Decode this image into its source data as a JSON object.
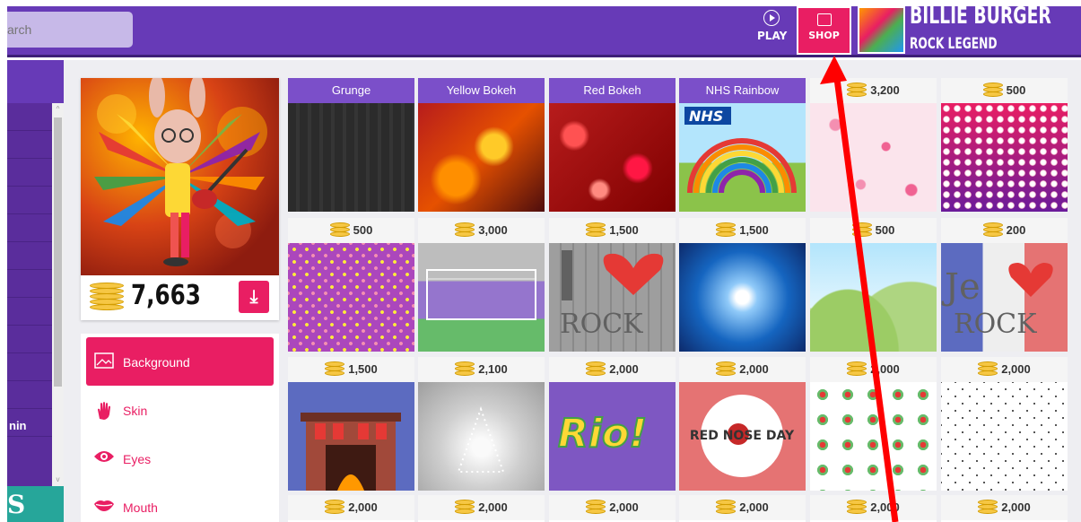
{
  "search": {
    "placeholder": "arch"
  },
  "header": {
    "play_label": "PLAY",
    "shop_label": "SHOP",
    "user_name": "BILLIE BURGER",
    "user_title": "ROCK LEGEND"
  },
  "leftnav": {
    "partial_label": "nin",
    "bottom_text": "S"
  },
  "preview": {
    "coins": "7,663"
  },
  "categories": [
    {
      "label": "Background",
      "icon": "image-icon",
      "active": true
    },
    {
      "label": "Skin",
      "icon": "hand-icon",
      "active": false
    },
    {
      "label": "Eyes",
      "icon": "eye-icon",
      "active": false
    },
    {
      "label": "Mouth",
      "icon": "lips-icon",
      "active": false
    }
  ],
  "tiles": [
    {
      "head": "Grunge",
      "named": true
    },
    {
      "head": "Yellow Bokeh",
      "named": true
    },
    {
      "head": "Red Bokeh",
      "named": true
    },
    {
      "head": "NHS Rainbow",
      "named": true
    },
    {
      "head": "3,200",
      "named": false
    },
    {
      "head": "500",
      "named": false
    },
    {
      "head": "500",
      "named": false
    },
    {
      "head": "3,000",
      "named": false
    },
    {
      "head": "1,500",
      "named": false
    },
    {
      "head": "1,500",
      "named": false
    },
    {
      "head": "500",
      "named": false
    },
    {
      "head": "200",
      "named": false
    },
    {
      "head": "1,500",
      "named": false
    },
    {
      "head": "2,100",
      "named": false
    },
    {
      "head": "2,000",
      "named": false
    },
    {
      "head": "2,000",
      "named": false
    },
    {
      "head": "2,000",
      "named": false
    },
    {
      "head": "2,000",
      "named": false
    },
    {
      "head": "2,000",
      "named": false
    },
    {
      "head": "2,000",
      "named": false
    },
    {
      "head": "2,000",
      "named": false
    },
    {
      "head": "2,000",
      "named": false
    },
    {
      "head": "2,000",
      "named": false
    },
    {
      "head": "2,000",
      "named": false
    }
  ],
  "tile_art": {
    "nhs_logo": "NHS",
    "rock_text": "ROCK",
    "je_text": "Je",
    "rio_text": "Rio!",
    "red_nose_text": "RED NOSE DAY"
  },
  "colors": {
    "header": "#673ab7",
    "accent": "#e91e63",
    "arrow": "#ff0000"
  }
}
